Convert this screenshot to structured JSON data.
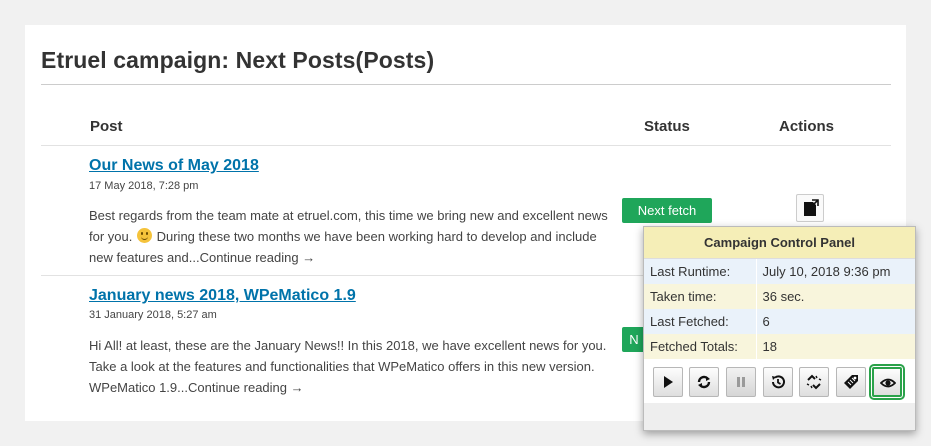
{
  "page": {
    "title": "Etruel campaign: Next Posts(Posts)"
  },
  "table": {
    "headers": {
      "post": "Post",
      "status": "Status",
      "actions": "Actions"
    },
    "rows": [
      {
        "title": "Our News of May 2018",
        "date": "17 May 2018, 7:28 pm",
        "excerpt_before": "Best regards from the team mate at etruel.com, this time we bring new and excellent news for you.",
        "excerpt_after": "During these two months we have been working hard to develop and include new features and...",
        "continue": "Continue reading →",
        "status": "Next fetch"
      },
      {
        "title": "January news 2018, WPeMatico 1.9",
        "date": "31 January 2018, 5:27 am",
        "excerpt": "Hi All! at least, these are the January News!! In this 2018, we have excellent news for you. Take a look at the features and functionalities that WPeMatico offers in this new version. WPeMatico 1.9...",
        "continue": "Continue reading →",
        "status": "N"
      }
    ]
  },
  "control_panel": {
    "title": "Campaign Control Panel",
    "rows": [
      {
        "label": "Last Runtime:",
        "value": "July 10, 2018 9:36 pm"
      },
      {
        "label": "Taken time:",
        "value": "36 sec."
      },
      {
        "label": "Last Fetched:",
        "value": "6"
      },
      {
        "label": "Fetched Totals:",
        "value": "18"
      }
    ],
    "buttons": [
      "play-icon",
      "refresh-icon",
      "pause-icon",
      "history-icon",
      "broken-link-icon",
      "tag-icon",
      "eye-icon"
    ],
    "selected_button": "eye-icon"
  },
  "colors": {
    "link": "#0073aa",
    "status_green": "#1fa65a",
    "panel_header": "#f5eeb7",
    "selection_outline": "#2aa24a"
  }
}
